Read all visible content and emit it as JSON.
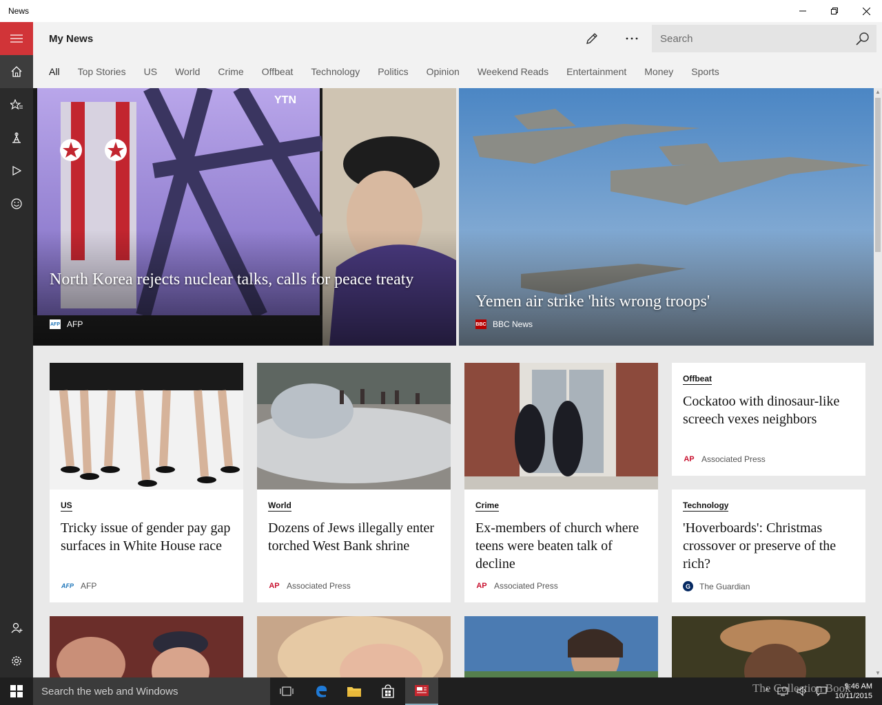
{
  "window": {
    "title": "News"
  },
  "header": {
    "title": "My News",
    "search_placeholder": "Search"
  },
  "tabs": [
    {
      "label": "All",
      "active": true
    },
    {
      "label": "Top Stories"
    },
    {
      "label": "US"
    },
    {
      "label": "World"
    },
    {
      "label": "Crime"
    },
    {
      "label": "Offbeat"
    },
    {
      "label": "Technology"
    },
    {
      "label": "Politics"
    },
    {
      "label": "Opinion"
    },
    {
      "label": "Weekend Reads"
    },
    {
      "label": "Entertainment"
    },
    {
      "label": "Money"
    },
    {
      "label": "Sports"
    }
  ],
  "hero": [
    {
      "headline": "North Korea rejects nuclear talks, calls for peace treaty",
      "source": "AFP"
    },
    {
      "headline": "Yemen air strike 'hits wrong troops'",
      "source": "BBC News"
    }
  ],
  "cards": [
    {
      "category": "US",
      "title": "Tricky issue of gender pay gap surfaces in White House race",
      "source": "AFP"
    },
    {
      "category": "World",
      "title": "Dozens of Jews illegally enter torched West Bank shrine",
      "source": "Associated Press"
    },
    {
      "category": "Crime",
      "title": "Ex-members of church where teens were beaten talk of decline",
      "source": "Associated Press"
    },
    {
      "category": "Offbeat",
      "title": "Cockatoo with dinosaur-like screech vexes neighbors",
      "source": "Associated Press"
    },
    {
      "category": "Technology",
      "title": "'Hoverboards': Christmas crossover or preserve of the rich?",
      "source": "The Guardian"
    }
  ],
  "taskbar": {
    "search_placeholder": "Search the web and Windows",
    "watermark": "The Collection Book",
    "time": "9:46 AM",
    "date": "10/11/2015"
  },
  "colors": {
    "accent": "#d13438",
    "rail": "#2b2b2b",
    "header": "#f2f2f2"
  }
}
